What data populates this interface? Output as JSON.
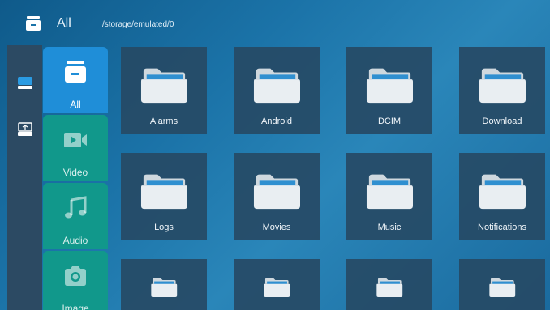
{
  "header": {
    "icon": "storage-drawer-icon",
    "title": "All",
    "path": "/storage/emulated/0"
  },
  "rail": {
    "items": [
      {
        "icon": "internal-storage-icon",
        "active": true
      },
      {
        "icon": "usb-drive-icon",
        "active": false
      }
    ]
  },
  "tabs": [
    {
      "label": "All",
      "icon": "all-files-icon",
      "active": true
    },
    {
      "label": "Video",
      "icon": "video-icon",
      "active": false
    },
    {
      "label": "Audio",
      "icon": "music-note-icon",
      "active": false
    },
    {
      "label": "Image",
      "icon": "camera-icon",
      "active": false
    }
  ],
  "folders": [
    {
      "name": "Alarms"
    },
    {
      "name": "Android"
    },
    {
      "name": "DCIM"
    },
    {
      "name": "Download"
    },
    {
      "name": "Logs"
    },
    {
      "name": "Movies"
    },
    {
      "name": "Music"
    },
    {
      "name": "Notifications"
    },
    {
      "name": ""
    },
    {
      "name": ""
    },
    {
      "name": ""
    },
    {
      "name": ""
    }
  ],
  "colors": {
    "active_tab": "#1f8ed8",
    "inactive_tab": "#11988b",
    "tile_bg": "#264a65",
    "rail_bg": "#2c4a63"
  }
}
